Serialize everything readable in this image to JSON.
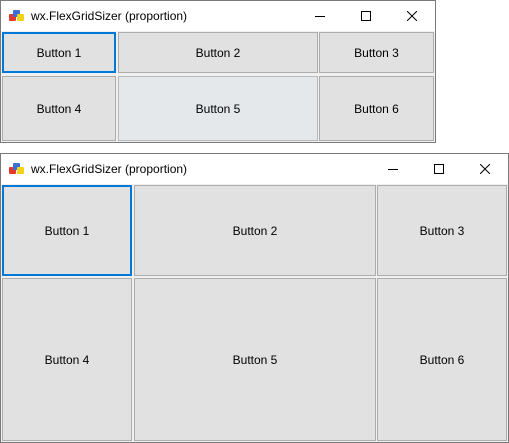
{
  "windows": [
    {
      "title": "wx.FlexGridSizer (proportion)",
      "buttons": [
        "Button 1",
        "Button 2",
        "Button 3",
        "Button 4",
        "Button 5",
        "Button 6"
      ]
    },
    {
      "title": "wx.FlexGridSizer (proportion)",
      "buttons": [
        "Button 1",
        "Button 2",
        "Button 3",
        "Button 4",
        "Button 5",
        "Button 6"
      ]
    }
  ],
  "caption_icons": [
    "minimize-icon",
    "maximize-icon",
    "close-icon"
  ],
  "colors": {
    "focus_border": "#0078d7",
    "button_face": "#e1e1e1",
    "window_bg": "#f0f0f0"
  }
}
